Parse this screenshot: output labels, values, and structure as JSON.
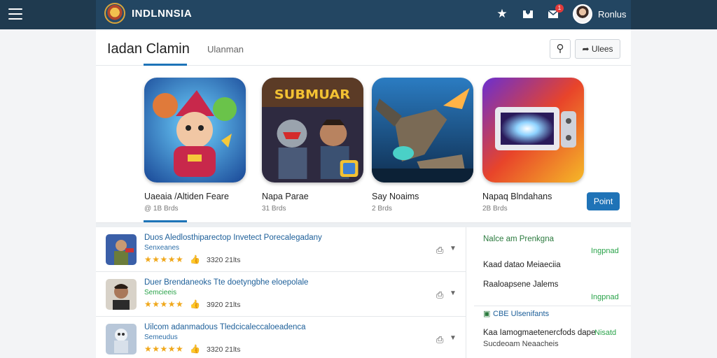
{
  "topbar": {
    "brand": "INDLNNSIA",
    "user_name": "Ronlus",
    "notification_count": "1",
    "icons": [
      "menu-icon",
      "star-icon",
      "inbox-icon",
      "mail-icon"
    ]
  },
  "header": {
    "title": "Iadan Clamin",
    "sub_tab": "Ulanman",
    "share_label": "Ulees"
  },
  "featured": [
    {
      "name": "Uaeaia /Altiden Feare",
      "meta": "@ 1B Brds"
    },
    {
      "name": "Napa Parae",
      "meta": "31 Brds",
      "banner": "SUBMUAR"
    },
    {
      "name": "Say Noaims",
      "meta": "2 Brds"
    },
    {
      "name": "Napaq Blndahans",
      "meta": "2B Brds"
    }
  ],
  "point_label": "Point",
  "list": [
    {
      "title": "Duos Aledlosthiparectop Invetect Porecalegadany",
      "sub": "Senxeanes",
      "stars": "★★★★★",
      "count": "3320 21lts"
    },
    {
      "title": "Duer Brendaneoks Tte doetyngbhe eloepolale",
      "sub": "Semcieeis",
      "stars": "★★★★★",
      "count": "3920 21lts"
    },
    {
      "title": "Uilcom adanmadous Tledcicaleccaloeadenca",
      "sub": "Semeudus",
      "stars": "★★★★★",
      "count": "3320 21lts"
    }
  ],
  "side": {
    "heading": "Nalce am Prenkgna",
    "link1": "Ingpnad",
    "item1": "Kaad datao Meiaeciia",
    "item2": "Raaloapsene Jalems",
    "link2": "Ingpnad",
    "heading2": "CBE Ulsenifants",
    "item3": "Kaa Iamogmaetenercfods dape",
    "item3_link": "Nisatd",
    "item4": "Sucdeoam Neaacheis"
  },
  "colors": {
    "topbar": "#1f3a4f",
    "accent": "#1f73b7",
    "link_green": "#2aa34a",
    "star": "#f0a81c"
  }
}
